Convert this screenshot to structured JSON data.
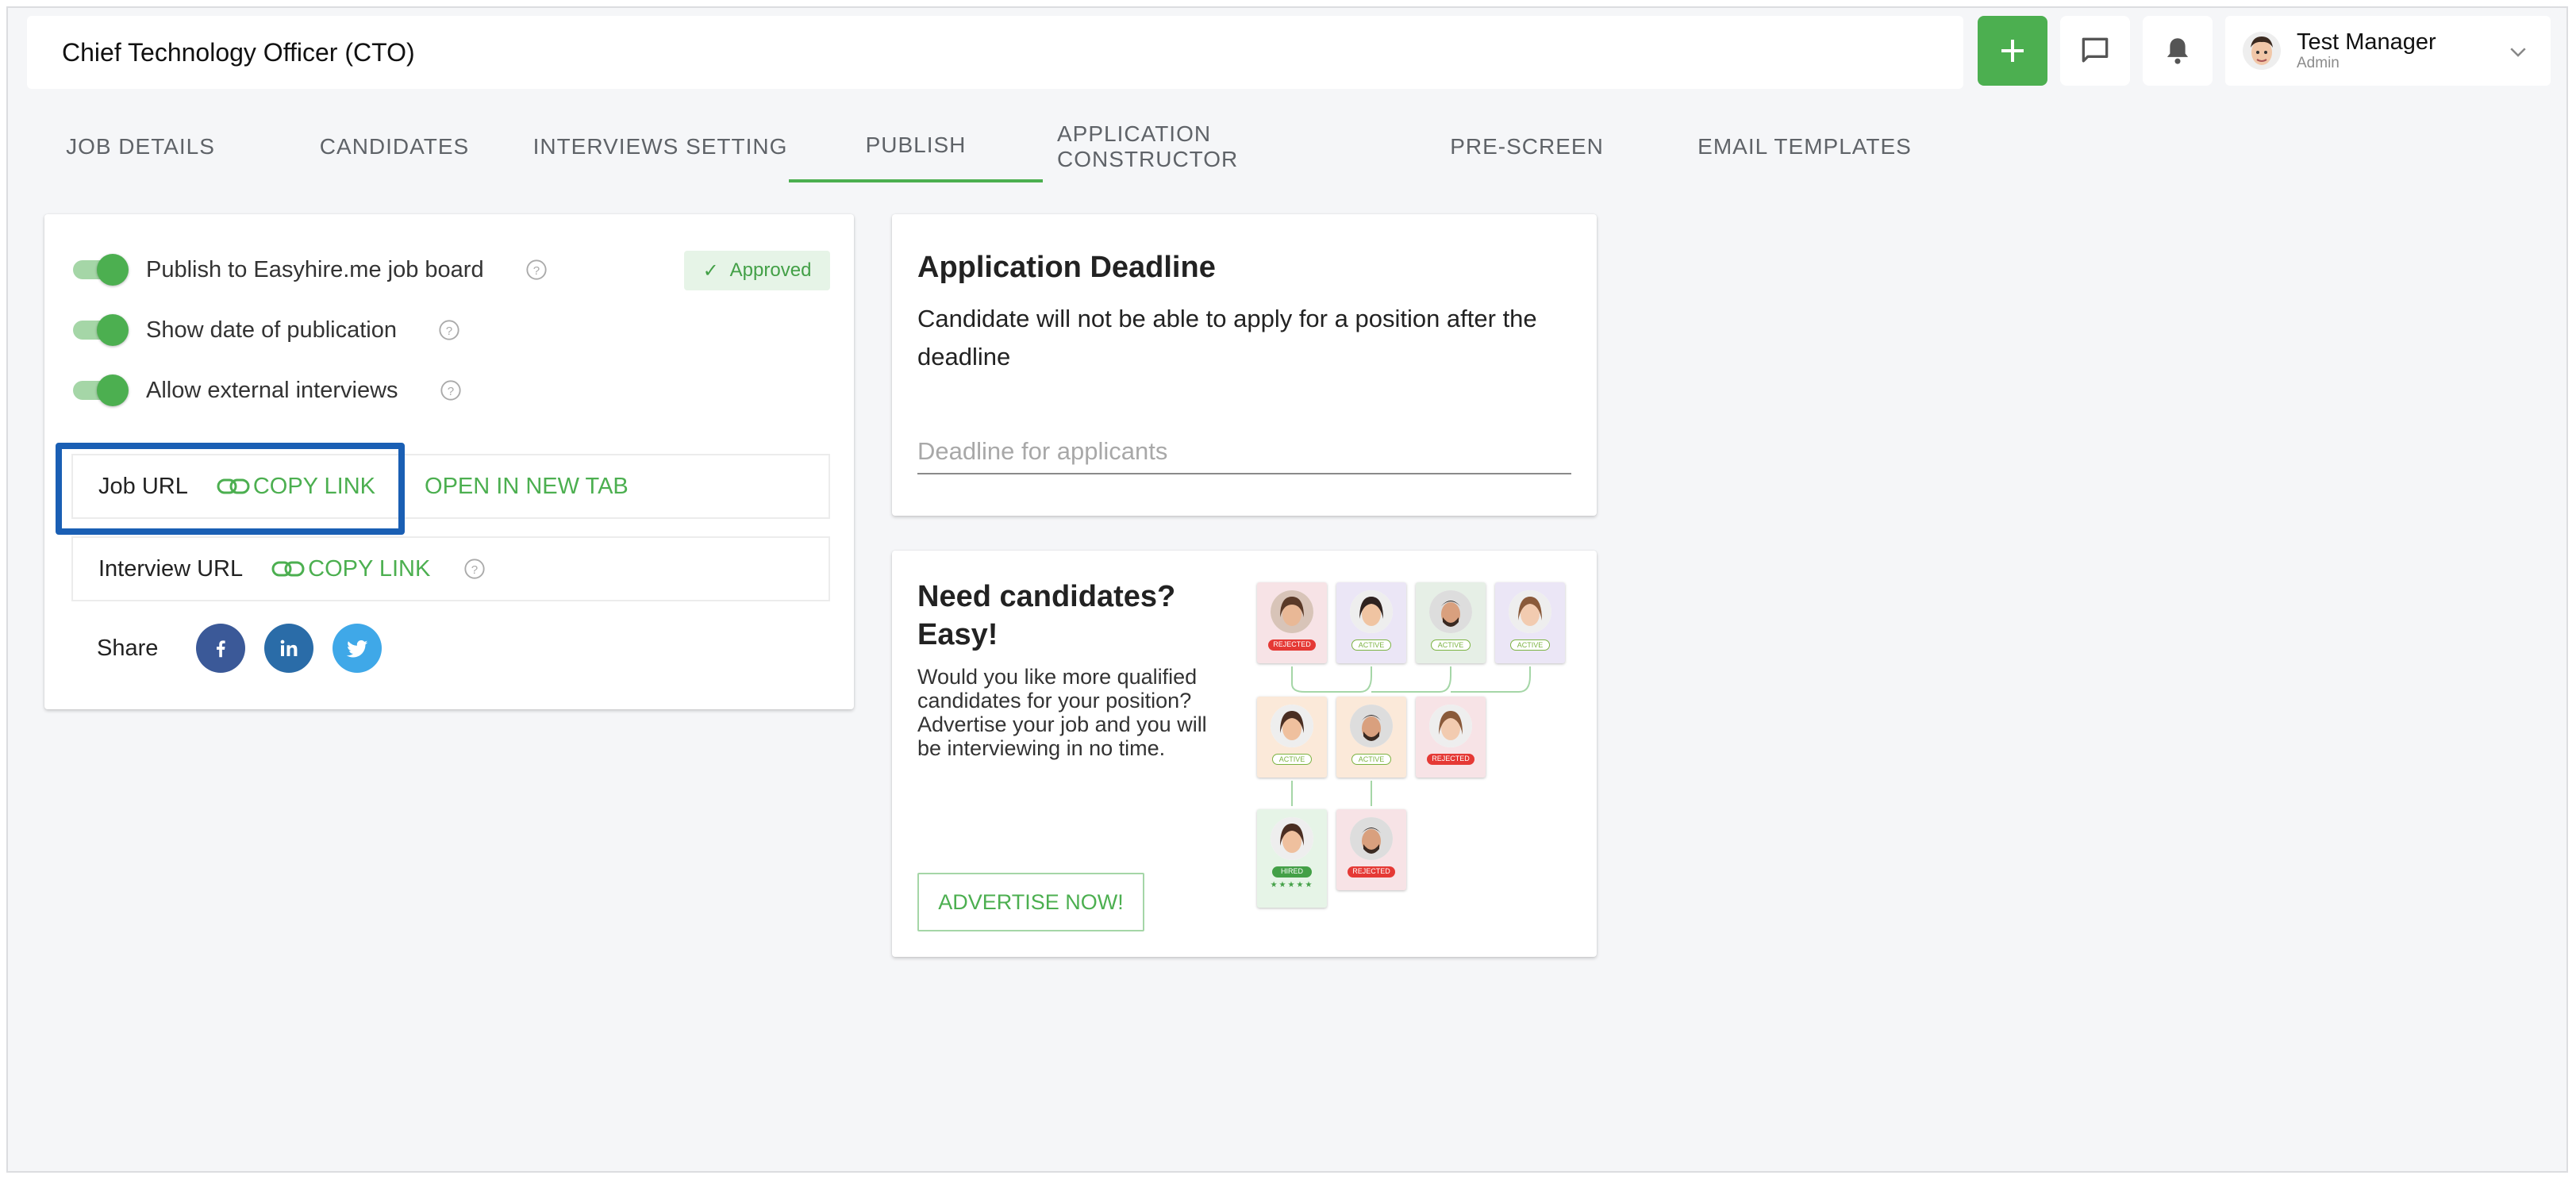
{
  "header": {
    "title": "Chief Technology Officer (CTO)",
    "add_icon": "plus-icon",
    "chat_icon": "chat-icon",
    "bell_icon": "bell-icon",
    "user": {
      "name": "Test Manager",
      "role": "Admin"
    }
  },
  "tabs": [
    {
      "label": "JOB DETAILS",
      "active": false
    },
    {
      "label": "CANDIDATES",
      "active": false
    },
    {
      "label": "INTERVIEWS SETTING",
      "active": false
    },
    {
      "label": "PUBLISH",
      "active": true
    },
    {
      "label": "APPLICATION CONSTRUCTOR",
      "active": false
    },
    {
      "label": "PRE-SCREEN",
      "active": false
    },
    {
      "label": "EMAIL TEMPLATES",
      "active": false
    }
  ],
  "publish": {
    "toggles": [
      {
        "label": "Publish to Easyhire.me job board",
        "on": true
      },
      {
        "label": "Show date of publication",
        "on": true
      },
      {
        "label": "Allow external interviews",
        "on": true
      }
    ],
    "approved_label": "Approved",
    "job_url": {
      "label": "Job URL",
      "copy": "COPY LINK",
      "open": "OPEN IN NEW TAB"
    },
    "interview_url": {
      "label": "Interview URL",
      "copy": "COPY LINK"
    },
    "share_label": "Share"
  },
  "deadline": {
    "title": "Application Deadline",
    "description": "Candidate will not be able to apply for a position after the deadline",
    "placeholder": "Deadline for applicants"
  },
  "advert": {
    "title": "Need candidates? Easy!",
    "description": "Would you like more qualified candidates for your position? Advertise your job and you will be interviewing in no time.",
    "button": "ADVERTISE NOW!",
    "statuses": {
      "rejected": "REJECTED",
      "active": "ACTIVE",
      "hired": "HIRED"
    }
  },
  "colors": {
    "accent": "#4caf50",
    "highlight": "#1a5fb4",
    "background": "#f5f6f8"
  }
}
